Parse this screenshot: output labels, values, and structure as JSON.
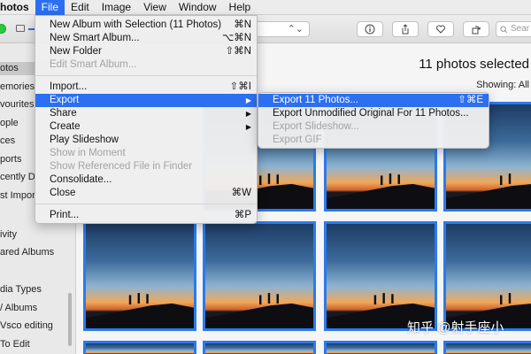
{
  "menubar": {
    "app": "Photos",
    "items": [
      "File",
      "Edit",
      "Image",
      "View",
      "Window",
      "Help"
    ]
  },
  "toolbar": {
    "search_placeholder": "Sear"
  },
  "sidebar": {
    "items": [
      "otos",
      "emories",
      "vourites",
      "ople",
      "ces",
      "ports",
      "cently D",
      "st Impor",
      "ivity",
      "ared Albums",
      "dia Types",
      "/ Albums",
      "Vsco editing",
      "To Edit"
    ]
  },
  "main": {
    "title": "11 photos selected",
    "showing": "Showing: All"
  },
  "file_menu": {
    "items": [
      {
        "label": "New Album with Selection (11 Photos)",
        "shortcut": "⌘N",
        "disabled": false
      },
      {
        "label": "New Smart Album...",
        "shortcut": "⌥⌘N",
        "disabled": false
      },
      {
        "label": "New Folder",
        "shortcut": "⇧⌘N",
        "disabled": false
      },
      {
        "label": "Edit Smart Album...",
        "shortcut": "",
        "disabled": true
      },
      {
        "label": "Import...",
        "shortcut": "⇧⌘I",
        "disabled": false
      },
      {
        "label": "Export",
        "shortcut": "▶",
        "disabled": false
      },
      {
        "label": "Share",
        "shortcut": "▶",
        "disabled": false
      },
      {
        "label": "Create",
        "shortcut": "▶",
        "disabled": false
      },
      {
        "label": "Play Slideshow",
        "shortcut": "",
        "disabled": false
      },
      {
        "label": "Show in Moment",
        "shortcut": "",
        "disabled": true
      },
      {
        "label": "Show Referenced File in Finder",
        "shortcut": "",
        "disabled": true
      },
      {
        "label": "Consolidate...",
        "shortcut": "",
        "disabled": false
      },
      {
        "label": "Close",
        "shortcut": "⌘W",
        "disabled": false
      },
      {
        "label": "Print...",
        "shortcut": "⌘P",
        "disabled": false
      }
    ]
  },
  "export_menu": {
    "items": [
      {
        "label": "Export 11 Photos...",
        "shortcut": "⇧⌘E",
        "disabled": false
      },
      {
        "label": "Export Unmodified Original For 11 Photos...",
        "shortcut": "",
        "disabled": false
      },
      {
        "label": "Export Slideshow...",
        "shortcut": "",
        "disabled": true
      },
      {
        "label": "Export GIF",
        "shortcut": "",
        "disabled": true
      }
    ]
  },
  "watermark": "知乎 @射手座小",
  "colors": {
    "accent": "#2c6ff0",
    "selection_border": "#2a7aee"
  },
  "icons": [
    "info-icon",
    "share-icon",
    "heart-icon",
    "rotate-icon",
    "search-icon"
  ]
}
